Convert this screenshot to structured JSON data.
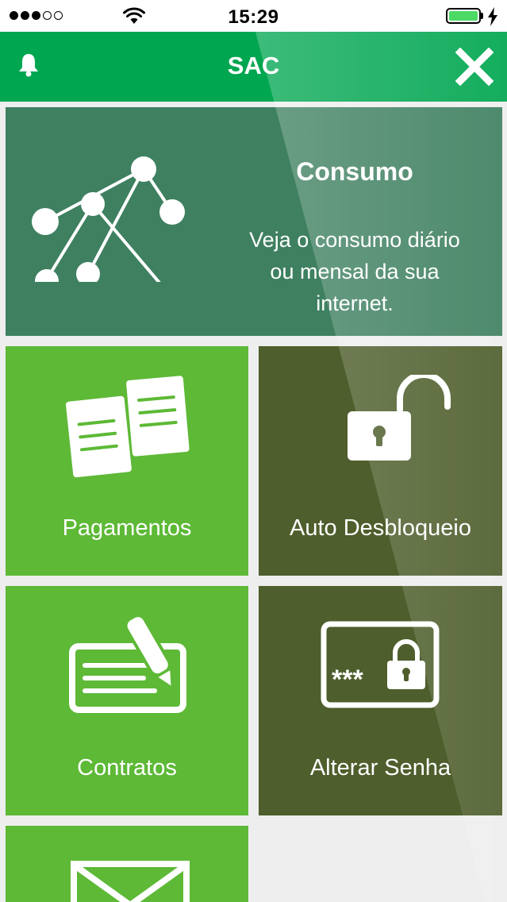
{
  "status_bar": {
    "time": "15:29",
    "signal_bars": 3,
    "signal_total": 5,
    "battery_icon": "battery-full-icon"
  },
  "nav": {
    "title": "SAC",
    "left_icon": "bell-icon",
    "right_icon": "close-icon"
  },
  "consumo": {
    "title": "Consumo",
    "description_lines": [
      "Veja o consumo diário",
      "ou mensal da sua",
      "internet."
    ],
    "icon": "network-graph-icon",
    "color": "#3e8060"
  },
  "tiles": [
    {
      "label": "Pagamentos",
      "icon": "documents-icon",
      "color": "#5db936"
    },
    {
      "label": "Auto Desbloqueio",
      "icon": "unlocked-padlock-icon",
      "color": "#4e5e2c"
    },
    {
      "label": "Contratos",
      "icon": "contract-pen-icon",
      "color": "#5db936"
    },
    {
      "label": "Alterar Senha",
      "icon": "password-lock-icon",
      "color": "#4e5e2c"
    },
    {
      "label": "",
      "icon": "envelope-icon",
      "color": "#5db936"
    }
  ],
  "colors": {
    "header": "#00a650",
    "background": "#eeeeee"
  }
}
